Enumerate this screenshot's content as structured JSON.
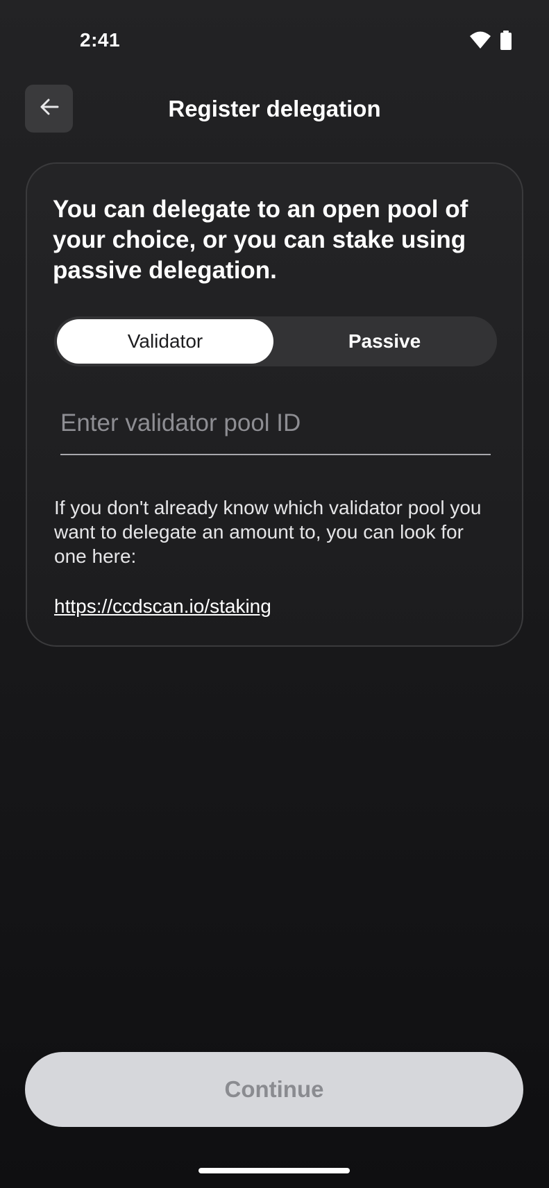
{
  "status_bar": {
    "time": "2:41",
    "icons": [
      "wifi-icon",
      "battery-icon"
    ]
  },
  "header": {
    "back_icon": "arrow-left-icon",
    "title": "Register delegation"
  },
  "card": {
    "heading": "You can delegate to an open pool of your choice, or you can stake using passive delegation.",
    "segment": {
      "options": [
        "Validator",
        "Passive"
      ],
      "selected": "Validator"
    },
    "pool_input": {
      "placeholder": "Enter validator pool ID",
      "value": ""
    },
    "help_text": "If you don't already know which validator pool you want to delegate an amount to, you can look for one here:",
    "help_link": "https://ccdscan.io/staking"
  },
  "footer": {
    "continue_label": "Continue"
  },
  "colors": {
    "background_top": "#232325",
    "background_bottom": "#0f0f11",
    "card_border": "#3a3a3c",
    "segment_active_bg": "#ffffff",
    "button_disabled_bg": "#d6d7db",
    "button_disabled_text": "#8a8b90"
  }
}
